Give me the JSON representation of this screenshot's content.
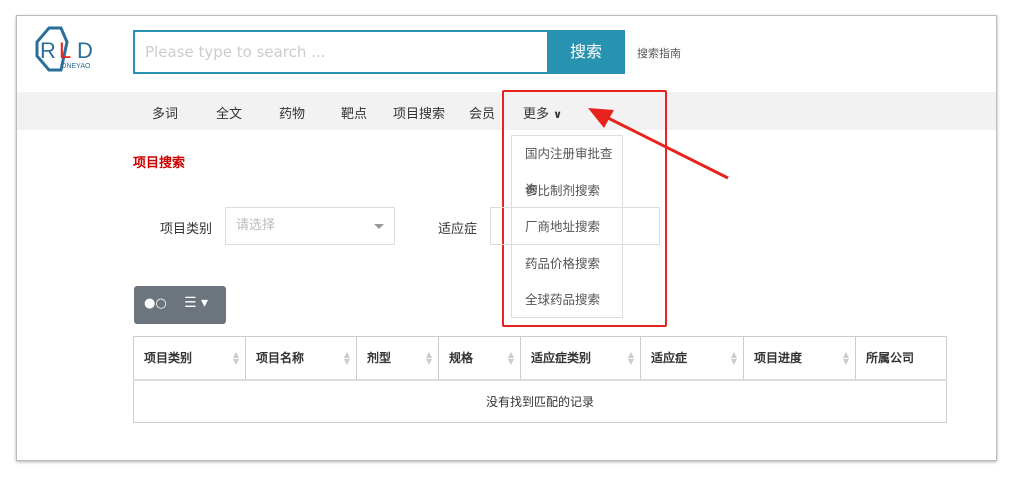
{
  "logo": {
    "text": "RLD",
    "sub": "ONEYAO"
  },
  "search": {
    "placeholder": "Please type to search ...",
    "button": "搜索",
    "guide": "搜索指南"
  },
  "nav": [
    "多词",
    "全文",
    "药物",
    "靶点",
    "项目搜索",
    "会员"
  ],
  "more": {
    "label": "更多",
    "items": [
      "国内注册审批查询",
      "参比制剂搜索",
      "厂商地址搜索",
      "药品价格搜索",
      "全球药品搜索"
    ]
  },
  "page_title": "项目搜索",
  "filters": {
    "category_label": "项目类别",
    "category_placeholder": "请选择",
    "indication_label": "适应症"
  },
  "table": {
    "columns": [
      "项目类别",
      "项目名称",
      "剂型",
      "规格",
      "适应症类别",
      "适应症",
      "项目进度",
      "所属公司"
    ],
    "empty": "没有找到匹配的记录"
  },
  "colors": {
    "accent": "#2893b0",
    "highlight": "#e8231e"
  }
}
